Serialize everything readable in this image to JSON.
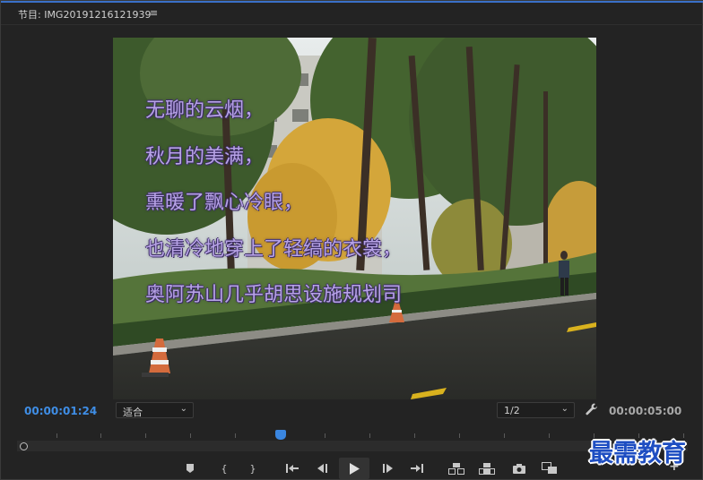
{
  "panel": {
    "title": "节目: IMG20191216121939",
    "menu_icon": "hamburger-menu-icon",
    "accent_color": "#3a70c8"
  },
  "viewer": {
    "poem_lines": [
      "无聊的云烟，",
      "秋月的美满，",
      "熏暖了飘心冷眼，",
      "也清冷地穿上了轻缟的衣裳，",
      "奥阿苏山几乎胡思设施规划司"
    ],
    "poem_color": "#b7a3e6"
  },
  "controls": {
    "current_timecode": "00:00:01:24",
    "fit_select": "适合",
    "resolution_select": "1/2",
    "duration_timecode": "00:00:05:00",
    "wrench_icon": "wrench-icon",
    "timecode_color": "#3f8ee6"
  },
  "transport": {
    "buttons": [
      "add-marker-icon",
      "mark-in-icon",
      "mark-out-icon",
      "go-to-in-icon",
      "step-back-icon",
      "play-icon",
      "step-forward-icon",
      "go-to-out-icon",
      "insert-icon",
      "overwrite-icon",
      "export-frame-icon",
      "comparison-view-icon"
    ],
    "add_button": "+"
  },
  "watermark": {
    "text": "最需教育"
  }
}
